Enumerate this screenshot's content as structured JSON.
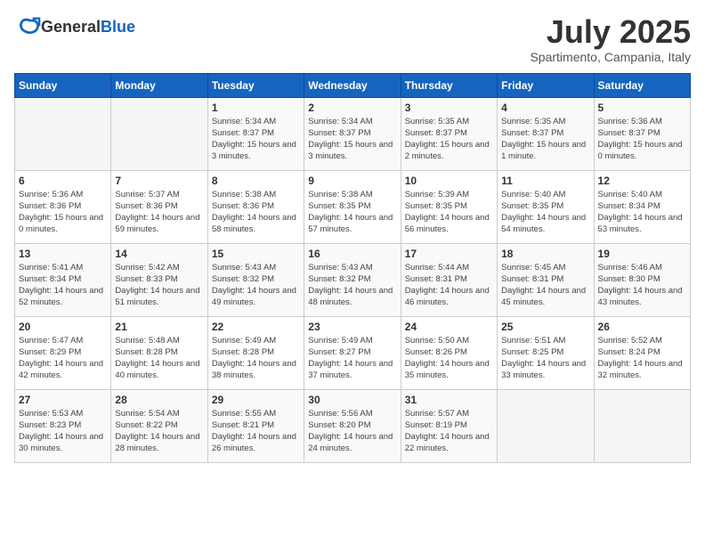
{
  "header": {
    "logo": {
      "general": "General",
      "blue": "Blue"
    },
    "title": "July 2025",
    "subtitle": "Spartimento, Campania, Italy"
  },
  "weekdays": [
    "Sunday",
    "Monday",
    "Tuesday",
    "Wednesday",
    "Thursday",
    "Friday",
    "Saturday"
  ],
  "weeks": [
    [
      {
        "day": "",
        "empty": true
      },
      {
        "day": "",
        "empty": true
      },
      {
        "day": "1",
        "sunrise": "Sunrise: 5:34 AM",
        "sunset": "Sunset: 8:37 PM",
        "daylight": "Daylight: 15 hours and 3 minutes."
      },
      {
        "day": "2",
        "sunrise": "Sunrise: 5:34 AM",
        "sunset": "Sunset: 8:37 PM",
        "daylight": "Daylight: 15 hours and 3 minutes."
      },
      {
        "day": "3",
        "sunrise": "Sunrise: 5:35 AM",
        "sunset": "Sunset: 8:37 PM",
        "daylight": "Daylight: 15 hours and 2 minutes."
      },
      {
        "day": "4",
        "sunrise": "Sunrise: 5:35 AM",
        "sunset": "Sunset: 8:37 PM",
        "daylight": "Daylight: 15 hours and 1 minute."
      },
      {
        "day": "5",
        "sunrise": "Sunrise: 5:36 AM",
        "sunset": "Sunset: 8:37 PM",
        "daylight": "Daylight: 15 hours and 0 minutes."
      }
    ],
    [
      {
        "day": "6",
        "sunrise": "Sunrise: 5:36 AM",
        "sunset": "Sunset: 8:36 PM",
        "daylight": "Daylight: 15 hours and 0 minutes."
      },
      {
        "day": "7",
        "sunrise": "Sunrise: 5:37 AM",
        "sunset": "Sunset: 8:36 PM",
        "daylight": "Daylight: 14 hours and 59 minutes."
      },
      {
        "day": "8",
        "sunrise": "Sunrise: 5:38 AM",
        "sunset": "Sunset: 8:36 PM",
        "daylight": "Daylight: 14 hours and 58 minutes."
      },
      {
        "day": "9",
        "sunrise": "Sunrise: 5:38 AM",
        "sunset": "Sunset: 8:35 PM",
        "daylight": "Daylight: 14 hours and 57 minutes."
      },
      {
        "day": "10",
        "sunrise": "Sunrise: 5:39 AM",
        "sunset": "Sunset: 8:35 PM",
        "daylight": "Daylight: 14 hours and 56 minutes."
      },
      {
        "day": "11",
        "sunrise": "Sunrise: 5:40 AM",
        "sunset": "Sunset: 8:35 PM",
        "daylight": "Daylight: 14 hours and 54 minutes."
      },
      {
        "day": "12",
        "sunrise": "Sunrise: 5:40 AM",
        "sunset": "Sunset: 8:34 PM",
        "daylight": "Daylight: 14 hours and 53 minutes."
      }
    ],
    [
      {
        "day": "13",
        "sunrise": "Sunrise: 5:41 AM",
        "sunset": "Sunset: 8:34 PM",
        "daylight": "Daylight: 14 hours and 52 minutes."
      },
      {
        "day": "14",
        "sunrise": "Sunrise: 5:42 AM",
        "sunset": "Sunset: 8:33 PM",
        "daylight": "Daylight: 14 hours and 51 minutes."
      },
      {
        "day": "15",
        "sunrise": "Sunrise: 5:43 AM",
        "sunset": "Sunset: 8:32 PM",
        "daylight": "Daylight: 14 hours and 49 minutes."
      },
      {
        "day": "16",
        "sunrise": "Sunrise: 5:43 AM",
        "sunset": "Sunset: 8:32 PM",
        "daylight": "Daylight: 14 hours and 48 minutes."
      },
      {
        "day": "17",
        "sunrise": "Sunrise: 5:44 AM",
        "sunset": "Sunset: 8:31 PM",
        "daylight": "Daylight: 14 hours and 46 minutes."
      },
      {
        "day": "18",
        "sunrise": "Sunrise: 5:45 AM",
        "sunset": "Sunset: 8:31 PM",
        "daylight": "Daylight: 14 hours and 45 minutes."
      },
      {
        "day": "19",
        "sunrise": "Sunrise: 5:46 AM",
        "sunset": "Sunset: 8:30 PM",
        "daylight": "Daylight: 14 hours and 43 minutes."
      }
    ],
    [
      {
        "day": "20",
        "sunrise": "Sunrise: 5:47 AM",
        "sunset": "Sunset: 8:29 PM",
        "daylight": "Daylight: 14 hours and 42 minutes."
      },
      {
        "day": "21",
        "sunrise": "Sunrise: 5:48 AM",
        "sunset": "Sunset: 8:28 PM",
        "daylight": "Daylight: 14 hours and 40 minutes."
      },
      {
        "day": "22",
        "sunrise": "Sunrise: 5:49 AM",
        "sunset": "Sunset: 8:28 PM",
        "daylight": "Daylight: 14 hours and 38 minutes."
      },
      {
        "day": "23",
        "sunrise": "Sunrise: 5:49 AM",
        "sunset": "Sunset: 8:27 PM",
        "daylight": "Daylight: 14 hours and 37 minutes."
      },
      {
        "day": "24",
        "sunrise": "Sunrise: 5:50 AM",
        "sunset": "Sunset: 8:26 PM",
        "daylight": "Daylight: 14 hours and 35 minutes."
      },
      {
        "day": "25",
        "sunrise": "Sunrise: 5:51 AM",
        "sunset": "Sunset: 8:25 PM",
        "daylight": "Daylight: 14 hours and 33 minutes."
      },
      {
        "day": "26",
        "sunrise": "Sunrise: 5:52 AM",
        "sunset": "Sunset: 8:24 PM",
        "daylight": "Daylight: 14 hours and 32 minutes."
      }
    ],
    [
      {
        "day": "27",
        "sunrise": "Sunrise: 5:53 AM",
        "sunset": "Sunset: 8:23 PM",
        "daylight": "Daylight: 14 hours and 30 minutes."
      },
      {
        "day": "28",
        "sunrise": "Sunrise: 5:54 AM",
        "sunset": "Sunset: 8:22 PM",
        "daylight": "Daylight: 14 hours and 28 minutes."
      },
      {
        "day": "29",
        "sunrise": "Sunrise: 5:55 AM",
        "sunset": "Sunset: 8:21 PM",
        "daylight": "Daylight: 14 hours and 26 minutes."
      },
      {
        "day": "30",
        "sunrise": "Sunrise: 5:56 AM",
        "sunset": "Sunset: 8:20 PM",
        "daylight": "Daylight: 14 hours and 24 minutes."
      },
      {
        "day": "31",
        "sunrise": "Sunrise: 5:57 AM",
        "sunset": "Sunset: 8:19 PM",
        "daylight": "Daylight: 14 hours and 22 minutes."
      },
      {
        "day": "",
        "empty": true
      },
      {
        "day": "",
        "empty": true
      }
    ]
  ]
}
